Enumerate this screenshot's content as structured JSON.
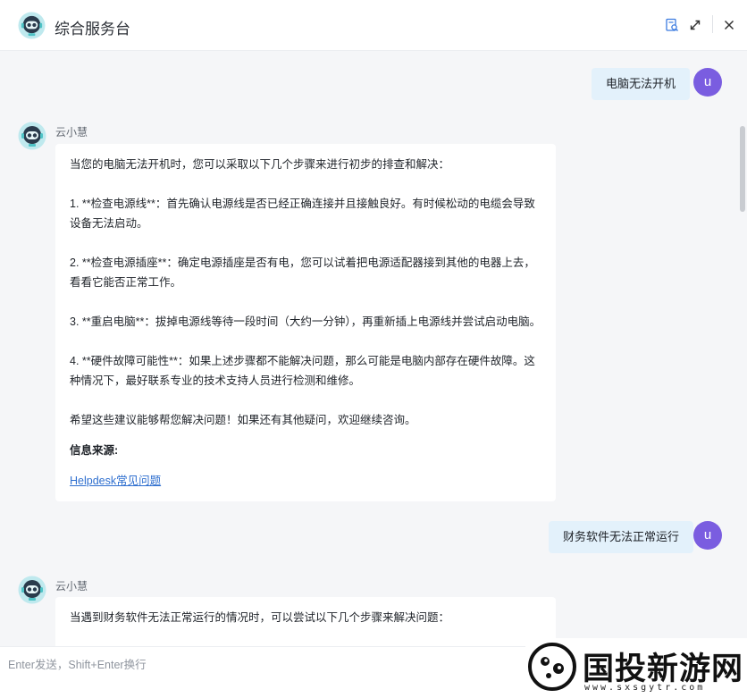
{
  "header": {
    "title": "综合服务台",
    "icons": [
      "knowledge-search-icon",
      "expand-icon",
      "close-icon"
    ]
  },
  "messages": [
    {
      "role": "user",
      "avatar_letter": "u",
      "text": "电脑无法开机"
    },
    {
      "role": "bot",
      "name": "云小慧",
      "paragraphs": [
        "当您的电脑无法开机时，您可以采取以下几个步骤来进行初步的排查和解决：",
        "1. **检查电源线**：首先确认电源线是否已经正确连接并且接触良好。有时候松动的电缆会导致设备无法启动。",
        "2. **检查电源插座**：确定电源插座是否有电，您可以试着把电源适配器接到其他的电器上去，看看它能否正常工作。",
        "3. **重启电脑**：拔掉电源线等待一段时间（大约一分钟），再重新插上电源线并尝试启动电脑。",
        "4. **硬件故障可能性**：如果上述步骤都不能解决问题，那么可能是电脑内部存在硬件故障。这种情况下，最好联系专业的技术支持人员进行检测和维修。",
        "希望这些建议能够帮您解决问题！如果还有其他疑问，欢迎继续咨询。"
      ],
      "source_title": "信息来源:",
      "source_link": "Helpdesk常见问题"
    },
    {
      "role": "user",
      "avatar_letter": "u",
      "text": "财务软件无法正常运行"
    },
    {
      "role": "bot",
      "name": "云小慧",
      "paragraphs": [
        "当遇到财务软件无法正常运行的情况时，可以尝试以下几个步骤来解决问题："
      ]
    }
  ],
  "input": {
    "placeholder": "Enter发送，Shift+Enter换行",
    "value": ""
  },
  "watermark": {
    "text": "国投新游网",
    "url": "www.sxsgytr.com"
  },
  "colors": {
    "user_bubble": "#e3f1fb",
    "user_avatar": "#7a5de0",
    "bot_avatar": "#4ec3c6",
    "link": "#2f6fcf",
    "background": "#f5f6f8"
  }
}
